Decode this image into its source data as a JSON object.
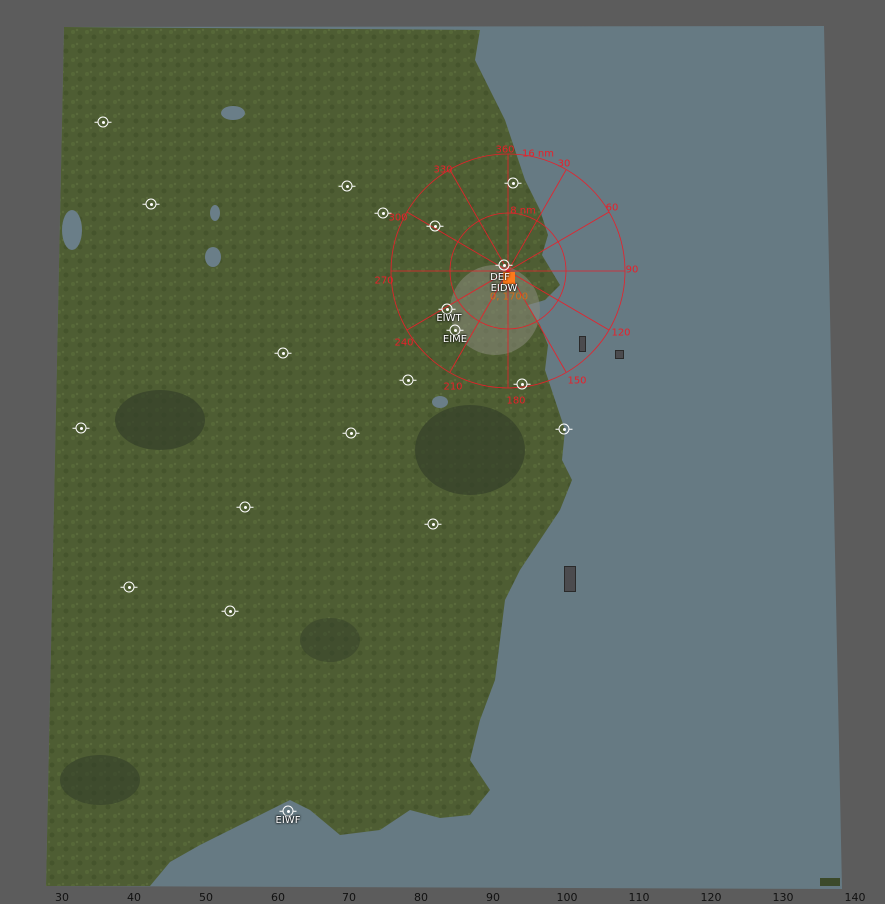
{
  "map": {
    "sea_color": "#667a83",
    "land_color": "#4e5d33",
    "background_color": "#5c5c5c",
    "overlay_color": "#e8202a"
  },
  "airports": [
    {
      "id": "eidw",
      "label": "EIDW"
    },
    {
      "id": "eiwt",
      "label": "EIWT"
    },
    {
      "id": "eime",
      "label": "EIME"
    },
    {
      "id": "eiwf",
      "label": "EIWF"
    }
  ],
  "range_ring": {
    "labels": [
      "16 nm",
      "8 nm"
    ],
    "bearings": [
      "360",
      "30",
      "60",
      "90",
      "120",
      "150",
      "180",
      "210",
      "240",
      "270",
      "300",
      "330"
    ]
  },
  "marker": {
    "callsign": "DEF",
    "altitude_text": "0, 1700"
  },
  "x_axis": {
    "ticks": [
      "30",
      "40",
      "50",
      "60",
      "70",
      "80",
      "90",
      "100",
      "110",
      "120",
      "130",
      "140"
    ]
  }
}
